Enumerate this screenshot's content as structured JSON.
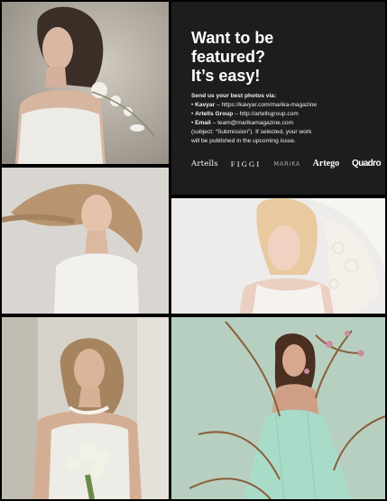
{
  "panel": {
    "headline": [
      "Want to be",
      "featured?",
      "It’s easy!"
    ],
    "lead": "Send us your best photos via:",
    "channels": [
      {
        "name": "Kavyar",
        "detail": " – https://kavyar.com/marika-magazine"
      },
      {
        "name": "Artells Group",
        "detail": " – http://artellsgroup.com"
      },
      {
        "name": "Email",
        "detail": " – team@marikamagazine.com"
      }
    ],
    "note": [
      "(subject: “Submission”). If selected, your work",
      "will be published in the upcoming issue."
    ],
    "bullet": "•",
    "logos": [
      "Artells",
      "FIGGI",
      "MARIKA",
      "Artego",
      "Quadro"
    ]
  },
  "colors": {
    "panel_bg": "#1d1d1d",
    "gutter": "#000000",
    "text": "#ffffff"
  }
}
